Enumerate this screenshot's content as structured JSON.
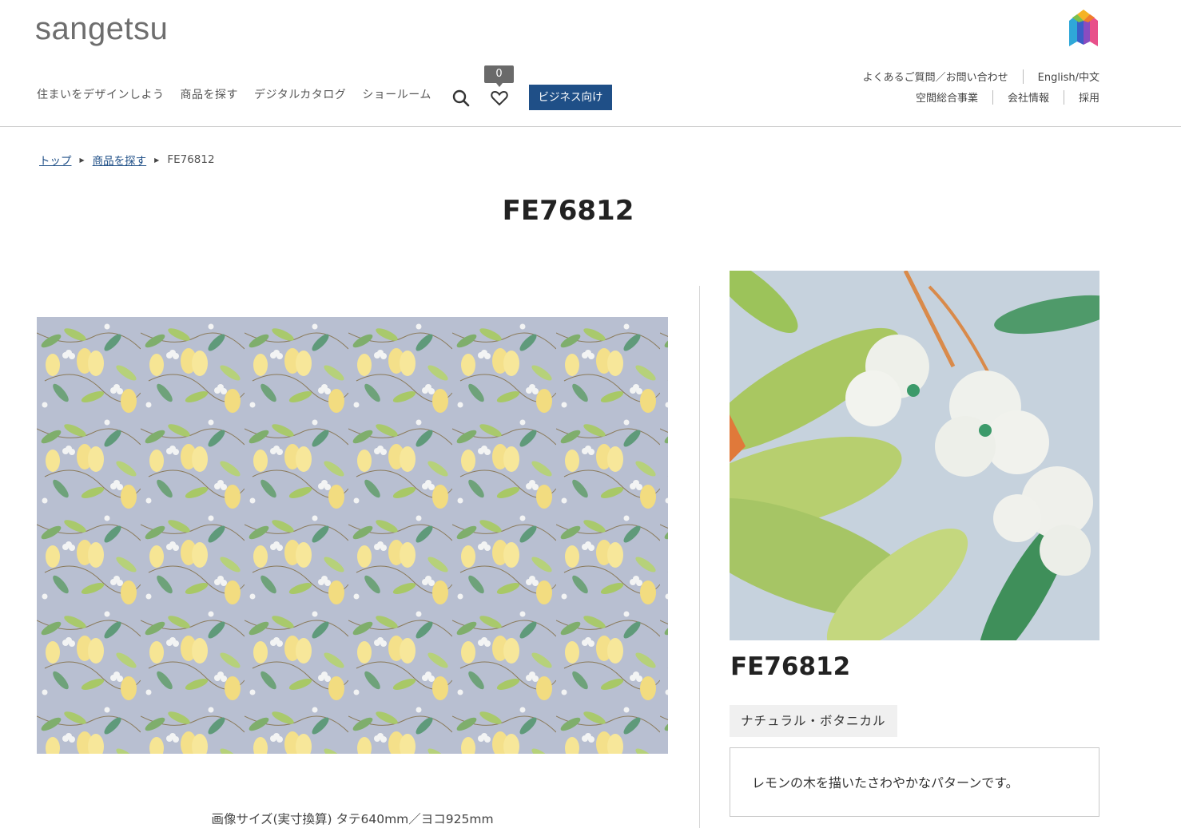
{
  "header": {
    "logo_text": "sangetsu",
    "nav_items": [
      "住まいをデザインしよう",
      "商品を探す",
      "デジタルカタログ",
      "ショールーム"
    ],
    "favorite_count": "0",
    "business_button": "ビジネス向け",
    "utility_row1": [
      "よくあるご質問／お問い合わせ",
      "English/中文"
    ],
    "utility_row2": [
      "空間総合事業",
      "会社情報",
      "採用"
    ],
    "icons": [
      "search-icon",
      "heart-icon",
      "brand-emblem-icon"
    ],
    "colors": {
      "accent": "#1f4f87",
      "badge": "#6a6a6a"
    }
  },
  "breadcrumb": {
    "items": [
      "トップ",
      "商品を探す"
    ],
    "current": "FE76812"
  },
  "product": {
    "title": "FE76812",
    "image_caption": "画像サイズ(実寸換算) タテ640mm／ヨコ925mm",
    "detail_code": "FE76812",
    "category_tag": "ナチュラル・ボタニカル",
    "description": "レモンの木を描いたさわやかなパターンです。"
  }
}
